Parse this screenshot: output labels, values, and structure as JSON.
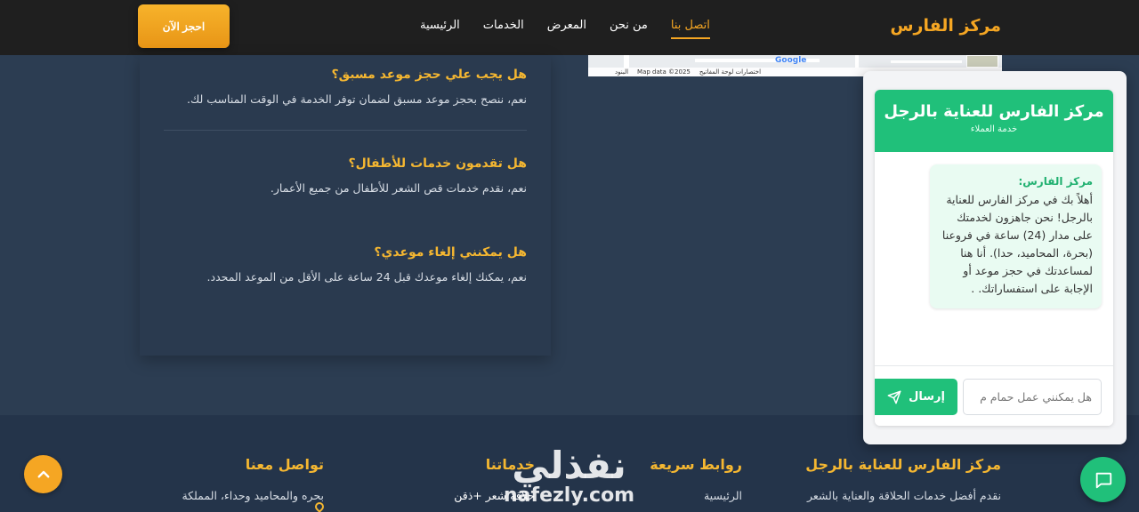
{
  "navbar": {
    "brand": "مركز الفارس",
    "links": [
      "الرئيسية",
      "الخدمات",
      "المعرض",
      "من نحن",
      "اتصل بنا"
    ],
    "active_link": "اتصل بنا",
    "book_button": "احجز الآن"
  },
  "map": {
    "attribution": "Map data ©2025",
    "shortcuts": "اختصارات لوحة المفاتيح",
    "terms": "البنود",
    "logo": "Google"
  },
  "faq": [
    {
      "question": "هل يجب علي حجز موعد مسبق؟",
      "answer": "نعم، ننصح بحجز موعد مسبق لضمان توفر الخدمة في الوقت المناسب لك."
    },
    {
      "question": "هل تقدمون خدمات للأطفال؟",
      "answer": "نعم، نقدم خدمات قص الشعر للأطفال من جميع الأعمار."
    },
    {
      "question": "هل يمكنني إلغاء موعدي؟",
      "answer": "نعم، يمكنك إلغاء موعدك قبل 24 ساعة على الأقل من الموعد المحدد."
    }
  ],
  "footer": {
    "about": {
      "title": "مركز الفارس للعناية بالرجل",
      "text": "نقدم أفضل خدمات الحلاقة والعناية بالشعر"
    },
    "quick_links": {
      "title": "روابط سريعة",
      "item": "الرئيسية"
    },
    "services": {
      "title": "خدماتنا",
      "item": "حلاقة شعر +ذقن"
    },
    "contact": {
      "title": "تواصل معنا",
      "text": "بحره والمحاميد وحداء، المملكة"
    }
  },
  "watermark": {
    "arabic": "نفذلي",
    "latin": "nafezly.com"
  },
  "chat": {
    "title": "مركز الفارس للعناية بالرجل",
    "subtitle": "خدمة العملاء",
    "message_sender": "مركز الفارس:",
    "message_text": "أهلاً بك في مركز الفارس للعناية بالرجل! نحن جاهزون لخدمتك على مدار (24) ساعة في فروعنا (بحرة، المحاميد، حدا). أنا هنا لمساعدتك في حجز موعد أو الإجابة على استفساراتك. .",
    "input_placeholder": "هل يمكنني عمل حمام م",
    "send_label": "إرسال"
  },
  "colors": {
    "accent": "#f5a623",
    "chat_green": "#20c07a",
    "navbar_bg": "#1f1f1f",
    "page_bg": "#2c3d52"
  },
  "icons": [
    "send-icon",
    "chevron-up-icon",
    "chat-bubble-icon",
    "location-pin-icon"
  ]
}
